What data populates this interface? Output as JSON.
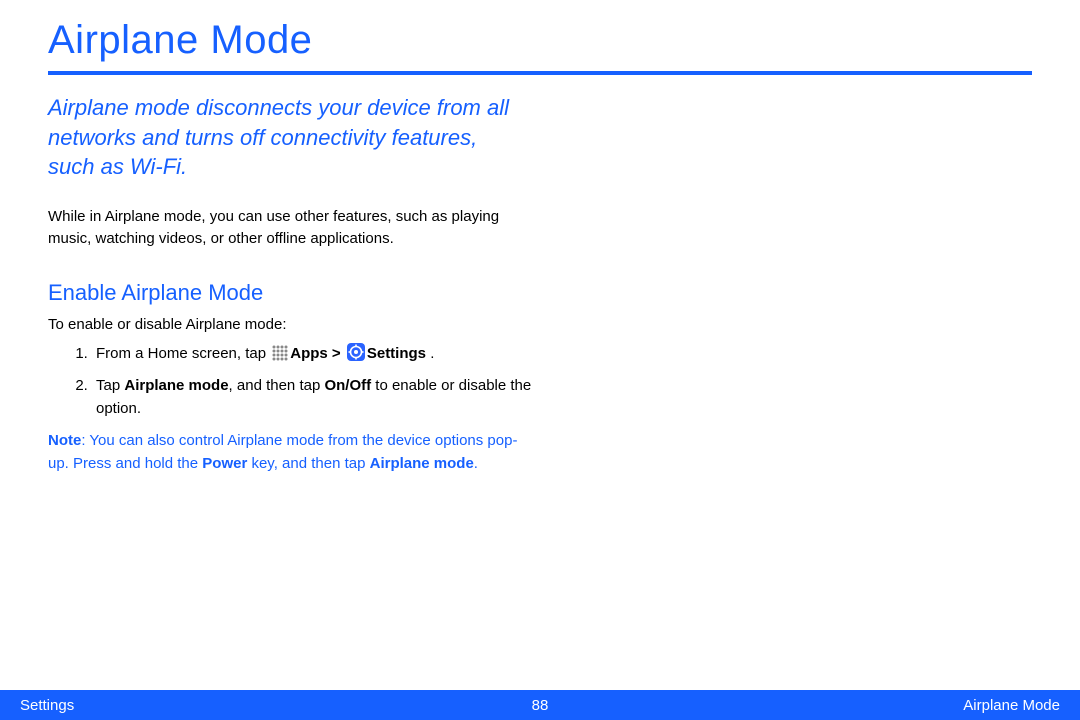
{
  "title": "Airplane Mode",
  "lead": "Airplane mode disconnects your device from all networks and turns off connectivity features, such as Wi-Fi.",
  "body": "While in Airplane mode, you can use other features, such as playing music, watching videos, or other offline applications.",
  "section": {
    "heading": "Enable Airplane Mode",
    "intro": "To enable or disable Airplane mode:",
    "steps": {
      "s1_pre": "From a Home screen, tap ",
      "s1_apps": "Apps",
      "s1_sep": " > ",
      "s1_settings": "Settings",
      "s1_post": " .",
      "s2_pre": "Tap ",
      "s2_b1": "Airplane mode",
      "s2_mid": ", and then tap ",
      "s2_b2": "On/Off",
      "s2_post": " to enable or disable the option."
    }
  },
  "note": {
    "label": "Note",
    "t1": ": You can also control Airplane mode from the device options pop-up. Press and hold the ",
    "b1": "Power",
    "t2": " key, and then tap ",
    "b2": "Airplane mode",
    "t3": "."
  },
  "footer": {
    "left": "Settings",
    "page": "88",
    "right": "Airplane Mode"
  }
}
